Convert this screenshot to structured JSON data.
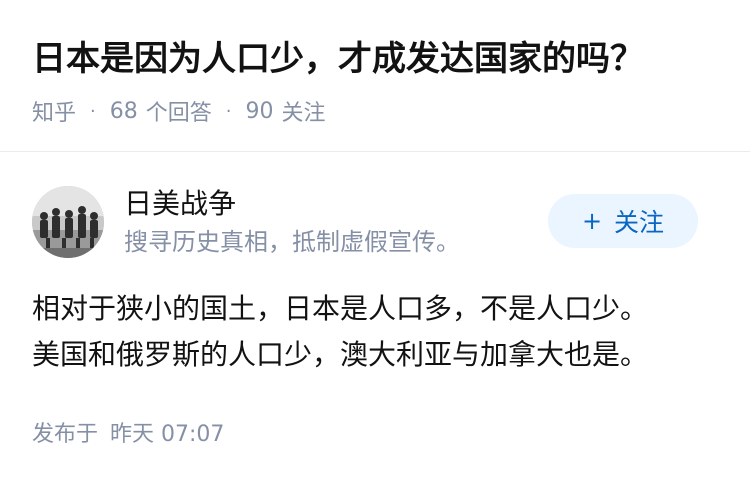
{
  "question": {
    "title": "日本是因为人口少，才成发达国家的吗？",
    "source": "知乎",
    "answer_count": "68",
    "answer_label": "个回答",
    "follower_count": "90",
    "follower_label": "关注",
    "separator": "·"
  },
  "author": {
    "name": "日美战争",
    "bio": "搜寻历史真相，抵制虚假宣传。",
    "avatar_icon": "avatar-photo-icon",
    "follow_plus": "+",
    "follow_label": "关注"
  },
  "answer": {
    "paragraphs": [
      "相对于狭小的国土，日本是人口多，不是人口少。",
      "美国和俄罗斯的人口少，澳大利亚与加拿大也是。"
    ],
    "published_label": "发布于",
    "published_time": "昨天 07:07"
  },
  "colors": {
    "text_primary": "#121212",
    "text_secondary": "#8590a6",
    "accent": "#0a66c2",
    "accent_bg": "#ebf5ff",
    "divider": "#ececec"
  }
}
